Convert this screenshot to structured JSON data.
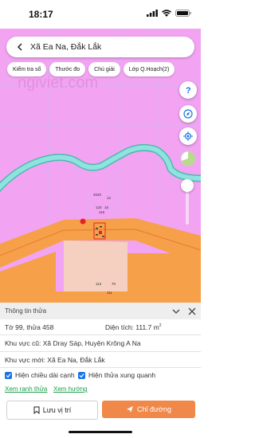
{
  "status": {
    "time": "18:17"
  },
  "search": {
    "text": "Xã Ea Na, Đắk Lắk"
  },
  "chips": [
    {
      "label": "Kiểm tra sổ"
    },
    {
      "label": "Thước đo"
    },
    {
      "label": "Chú giải"
    },
    {
      "label": "Lớp Q.Hoạch(2)"
    }
  ],
  "map": {
    "watermark": "ngiviet.com",
    "numbers": [
      "4020",
      "12",
      "120",
      "16",
      "115",
      "113",
      "70",
      "111"
    ],
    "colors": {
      "land": "#f2a4f2",
      "road": "#f6a04a",
      "river": "#7ed6d2",
      "parcel": "#e87a2a"
    }
  },
  "panel": {
    "title": "Thông tin thửa",
    "parcel": "Tờ 99, thửa 458",
    "area": "Diện tích: 111.7 m",
    "area_sup": "2",
    "old_area": "Khu vực cũ: Xã Dray Sáp, Huyện Krông A Na",
    "new_area": "Khu vực mới: Xã Ea Na, Đắk Lắk",
    "check_edges": "Hiện chiều dài cạnh",
    "check_neighbors": "Hiện thửa xung quanh",
    "link_boundary": "Xem ranh thửa",
    "link_direction": "Xem hướng",
    "save_label": "Lưu vị trí",
    "directions_label": "Chỉ đường"
  }
}
